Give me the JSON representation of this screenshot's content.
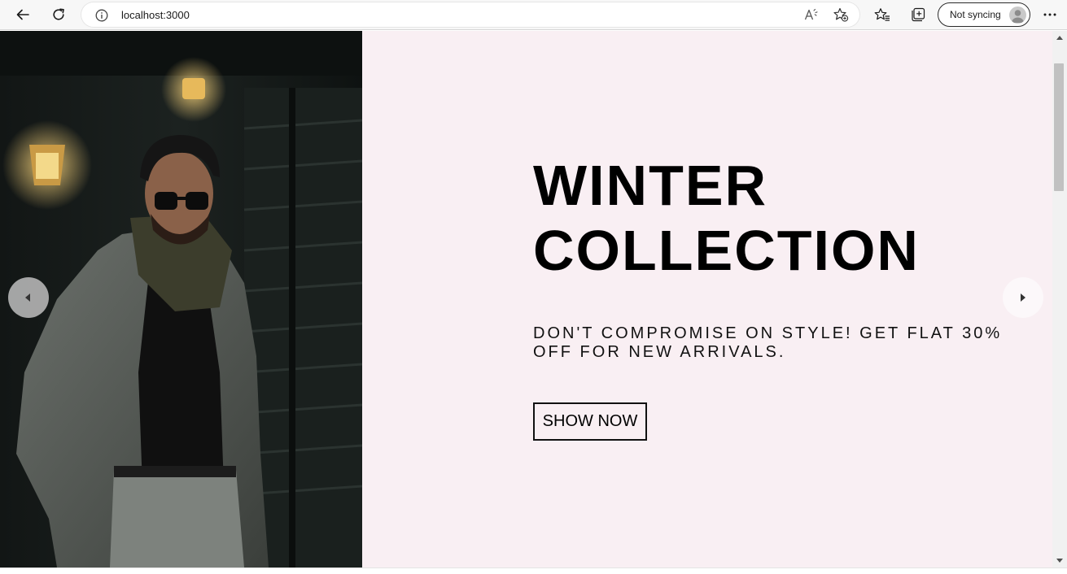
{
  "browser": {
    "url": "localhost:3000",
    "profile_label": "Not syncing",
    "icons": {
      "back": "back-arrow-icon",
      "refresh": "refresh-icon",
      "info": "info-icon",
      "read_aloud": "read-aloud-icon",
      "add_favorite": "add-favorite-icon",
      "favorites": "favorites-icon",
      "collections": "collections-icon",
      "more": "more-icon"
    }
  },
  "hero": {
    "title_line1": "WINTER",
    "title_line2": "COLLECTION",
    "subtitle": "DON'T COMPROMISE ON STYLE! GET FLAT 30% OFF FOR NEW ARRIVALS.",
    "cta_label": "SHOW NOW",
    "background_color": "#f9eff3",
    "text_color": "#000000"
  },
  "slider": {
    "prev_icon": "triangle-left-icon",
    "next_icon": "triangle-right-icon"
  }
}
